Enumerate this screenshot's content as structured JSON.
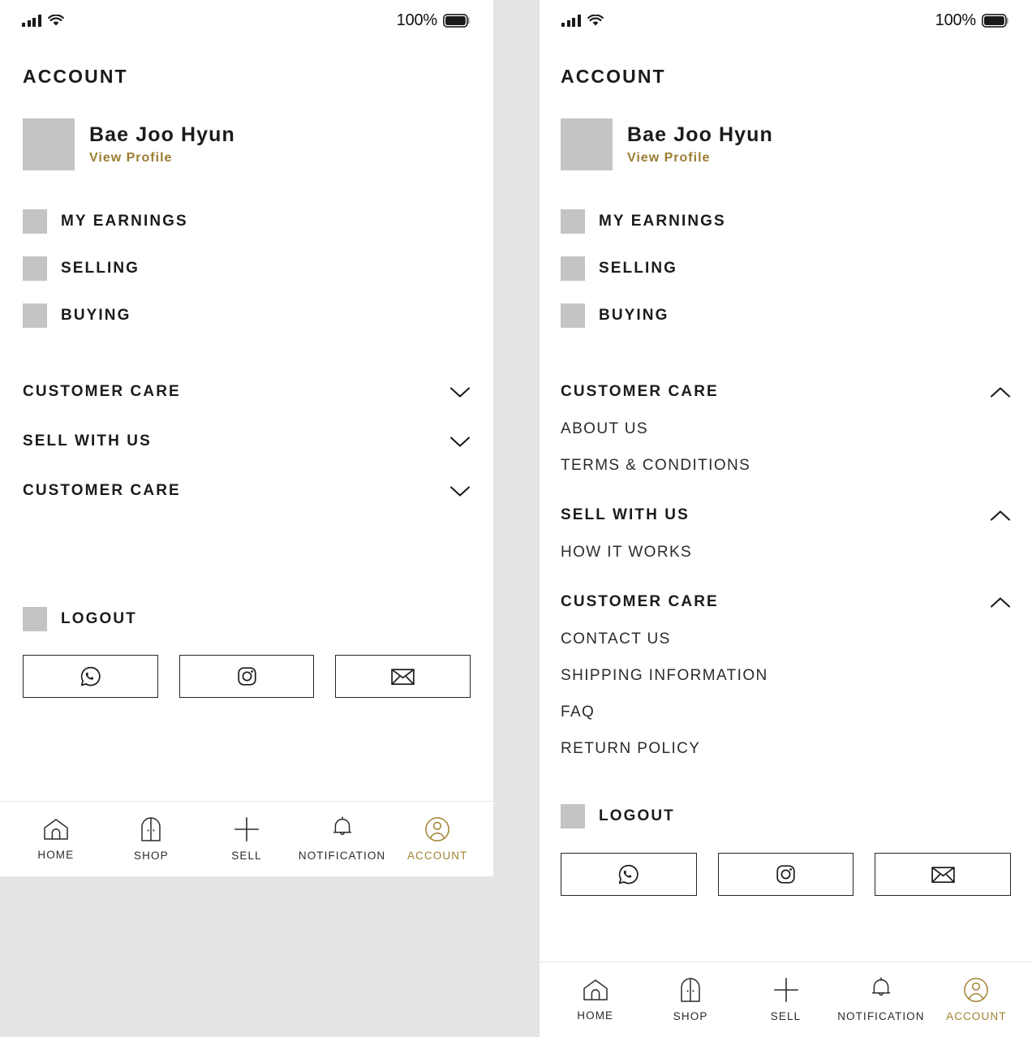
{
  "status_bar": {
    "battery_percent": "100%",
    "signal_icon": "signal-bars-icon",
    "wifi_icon": "wifi-icon",
    "battery_icon": "battery-full-icon"
  },
  "page_title": "ACCOUNT",
  "profile": {
    "name": "Bae Joo Hyun",
    "view_profile_label": "View Profile",
    "avatar_placeholder_color": "#c4c4c4"
  },
  "menu_rows": [
    {
      "label": "MY EARNINGS",
      "icon": "earnings-icon"
    },
    {
      "label": "SELLING",
      "icon": "selling-icon"
    },
    {
      "label": "BUYING",
      "icon": "buying-icon"
    }
  ],
  "accordions_collapsed": [
    {
      "title": "CUSTOMER CARE",
      "expanded": false,
      "chevron": "chevron-down-icon"
    },
    {
      "title": "SELL WITH US",
      "expanded": false,
      "chevron": "chevron-down-icon"
    },
    {
      "title": "CUSTOMER CARE",
      "expanded": false,
      "chevron": "chevron-down-icon"
    }
  ],
  "accordions_expanded": [
    {
      "title": "CUSTOMER CARE",
      "expanded": true,
      "chevron": "chevron-up-icon",
      "items": [
        "ABOUT US",
        "TERMS & CONDITIONS"
      ]
    },
    {
      "title": "SELL WITH US",
      "expanded": true,
      "chevron": "chevron-up-icon",
      "items": [
        "HOW IT WORKS"
      ]
    },
    {
      "title": "CUSTOMER CARE",
      "expanded": true,
      "chevron": "chevron-up-icon",
      "items": [
        "CONTACT US",
        "SHIPPING INFORMATION",
        "FAQ",
        "RETURN POLICY"
      ]
    }
  ],
  "logout": {
    "label": "LOGOUT",
    "icon": "logout-icon"
  },
  "social_buttons": [
    {
      "name": "whatsapp",
      "icon": "whatsapp-icon"
    },
    {
      "name": "instagram",
      "icon": "instagram-icon"
    },
    {
      "name": "email",
      "icon": "email-icon"
    }
  ],
  "tabbar": [
    {
      "label": "HOME",
      "icon": "home-icon",
      "active": false
    },
    {
      "label": "SHOP",
      "icon": "shop-door-icon",
      "active": false
    },
    {
      "label": "SELL",
      "icon": "plus-icon",
      "active": false
    },
    {
      "label": "NOTIFICATION",
      "icon": "bell-icon",
      "active": false
    },
    {
      "label": "ACCOUNT",
      "icon": "user-circle-icon",
      "active": true
    }
  ],
  "colors": {
    "accent_gold": "#9b7d32",
    "tab_active_gold": "#a3812f",
    "text_primary": "#1b1b1b",
    "placeholder_gray": "#c4c4c4",
    "page_background": "#e4e4e4",
    "panel_background": "#ffffff"
  }
}
